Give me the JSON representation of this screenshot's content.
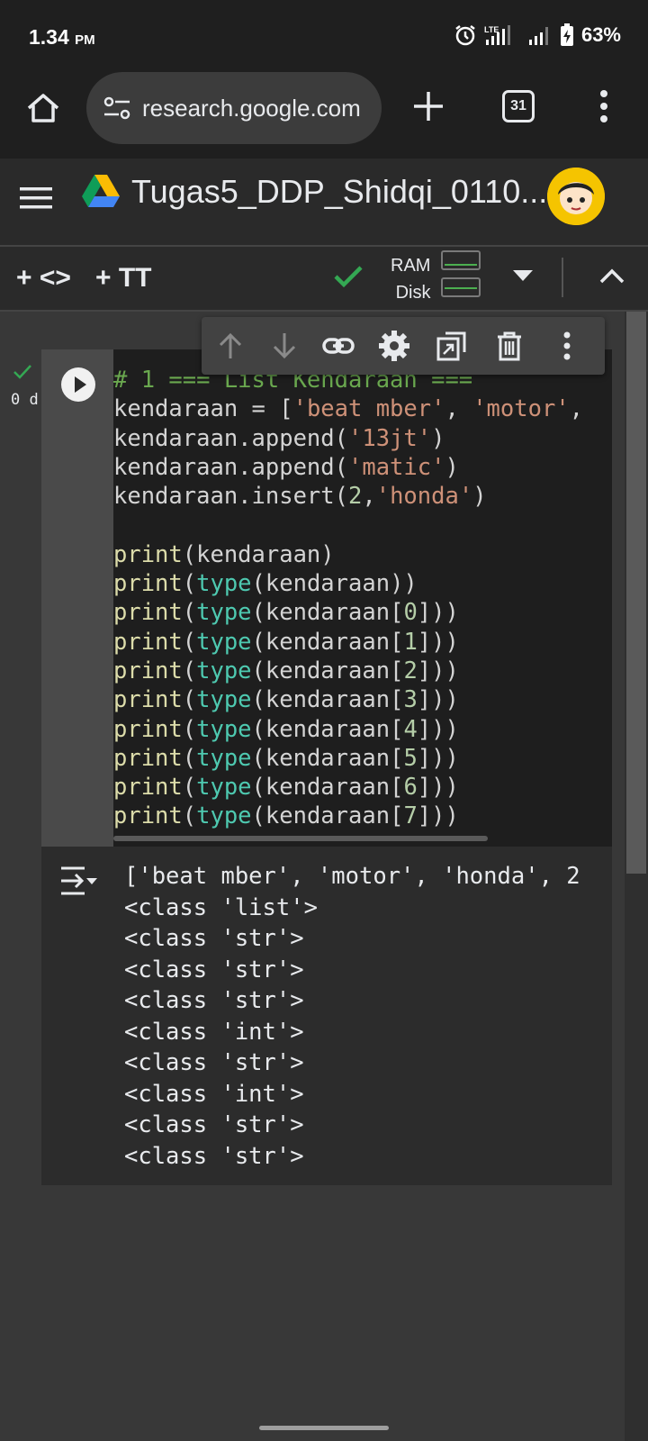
{
  "status_bar": {
    "time": "1.34",
    "ampm": "PM",
    "network": "LTE",
    "battery": "63%"
  },
  "browser": {
    "url": "research.google.com",
    "tab_count": "31"
  },
  "header": {
    "title": "Tugas5_DDP_Shidqi_0110..."
  },
  "toolbar": {
    "add_code_label": "+ <>",
    "add_text_label": "+ TT",
    "ram_label": "RAM",
    "disk_label": "Disk"
  },
  "cell": {
    "exec_time": "0 d",
    "code_lines": [
      "# 1 === List Kendaraan ===",
      "kendaraan = ['beat mber', 'motor',",
      "kendaraan.append('13jt')",
      "kendaraan.append('matic')",
      "kendaraan.insert(2,'honda')",
      "",
      "print(kendaraan)",
      "print(type(kendaraan))",
      "print(type(kendaraan[0]))",
      "print(type(kendaraan[1]))",
      "print(type(kendaraan[2]))",
      "print(type(kendaraan[3]))",
      "print(type(kendaraan[4]))",
      "print(type(kendaraan[5]))",
      "print(type(kendaraan[6]))",
      "print(type(kendaraan[7]))"
    ],
    "output_lines": [
      "['beat mber', 'motor', 'honda', 2",
      "<class 'list'>",
      "<class 'str'>",
      "<class 'str'>",
      "<class 'str'>",
      "<class 'int'>",
      "<class 'str'>",
      "<class 'int'>",
      "<class 'str'>",
      "<class 'str'>"
    ]
  },
  "colors": {
    "accent_green": "#34a853",
    "background": "#383838"
  }
}
